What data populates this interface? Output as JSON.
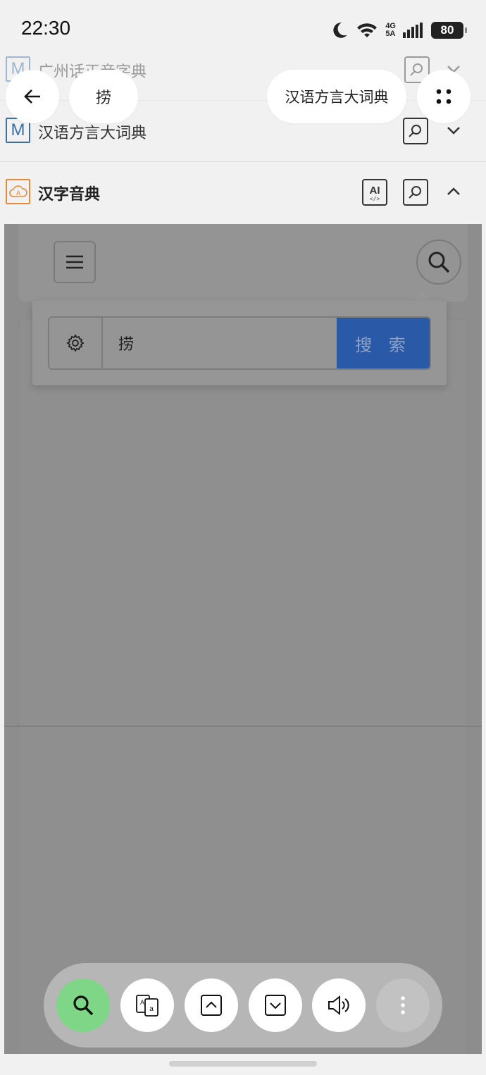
{
  "status": {
    "time": "22:30",
    "network_top": "4G",
    "network_bottom": "5A",
    "battery": "80"
  },
  "header": {
    "query_chip": "捞",
    "dictionary_chip": "汉语方言大词典"
  },
  "dictionaries": [
    {
      "name": "广州话正音字典",
      "logo": "M"
    },
    {
      "name": "汉语方言大词典",
      "logo": "M"
    },
    {
      "name": "汉字音典",
      "logo": "A"
    }
  ],
  "search": {
    "value": "捞",
    "submit_label": "搜 索"
  },
  "icons": {
    "back": "arrow-left-icon",
    "apps": "four-dots-icon",
    "ai": "ai-code-icon",
    "dict_search": "document-search-icon",
    "expand": "chevron-down-icon",
    "collapse": "chevron-up-icon",
    "menu": "hamburger-icon",
    "search": "search-icon",
    "settings": "gear-icon",
    "translate": "translate-icon",
    "prev": "chevron-up-box-icon",
    "next": "chevron-down-box-icon",
    "speak": "speaker-icon",
    "more": "more-vertical-icon"
  },
  "colors": {
    "search_button": "#2a5aa7",
    "active_tool": "#7ed686",
    "logo_blue": "#3f6fa6",
    "logo_orange": "#e8893a"
  }
}
